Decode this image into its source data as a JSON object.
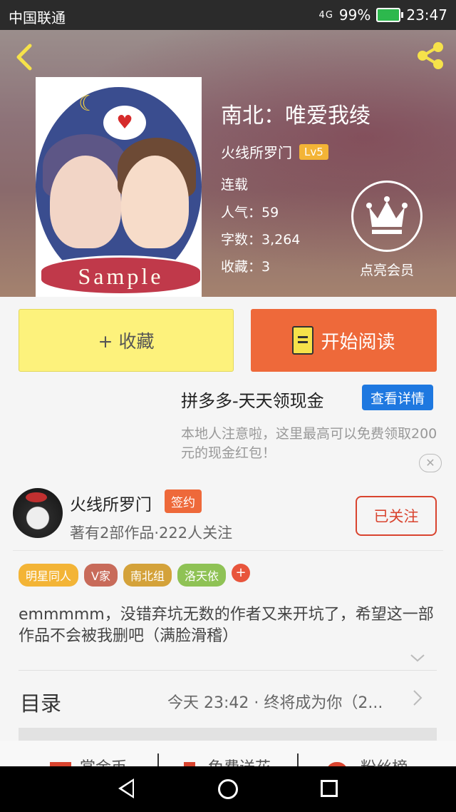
{
  "status_bar": {
    "carrier": "中国联通",
    "signal": "4G",
    "battery_pct": "99%",
    "time": "23:47"
  },
  "book": {
    "title": "南北：唯爱我绫",
    "author": "火线所罗门",
    "level": "Lv5",
    "status": "连载",
    "popularity": "人气：59",
    "word_count": "字数：3,264",
    "favorites": "收藏：3",
    "cover_text": "Sample"
  },
  "vip": {
    "label": "点亮会员"
  },
  "actions": {
    "favorite_label": "+ 收藏",
    "read_label": "开始阅读"
  },
  "ad": {
    "title": "拼多多-天天领现金",
    "button": "查看详情",
    "desc": "本地人注意啦，这里最高可以免费领取200元的现金红包！"
  },
  "author_info": {
    "name": "火线所罗门",
    "badge": "签约",
    "meta": "著有2部作品·222人关注",
    "follow_label": "已关注"
  },
  "tags": [
    {
      "label": "明星同人",
      "color": "#f3b436"
    },
    {
      "label": "V家",
      "color": "#c86b5a"
    },
    {
      "label": "南北组",
      "color": "#d4a23a"
    },
    {
      "label": "洛天依",
      "color": "#8fc255"
    }
  ],
  "tag_add": "+",
  "description": "emmmmm，没错弃坑无数的作者又来开坑了，希望这一部作品不会被我删吧（满脸滑稽）",
  "toc": {
    "label": "目录",
    "latest": "今天 23:42 · 终将成为你（2..."
  },
  "bottom_strip": {
    "item1": "赏金币",
    "item2": "免费送花",
    "item3": "粉丝榜"
  }
}
